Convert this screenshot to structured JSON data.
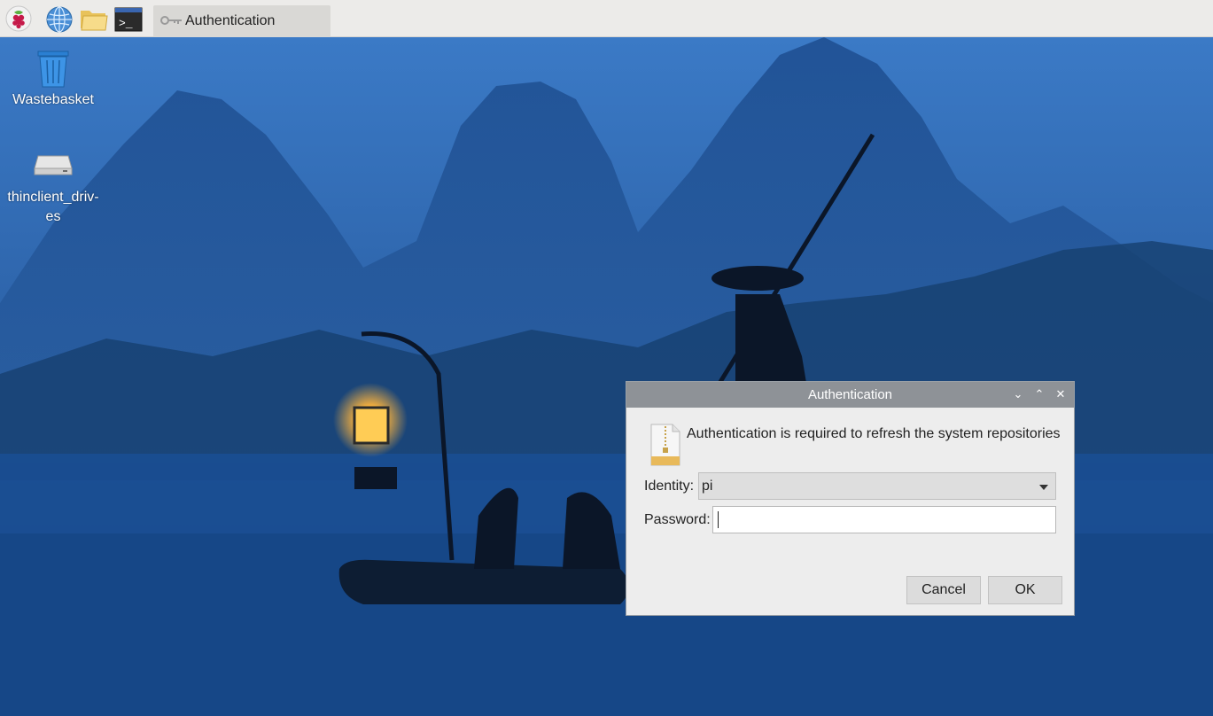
{
  "taskbar": {
    "launchers": [
      {
        "name": "raspberry-menu",
        "icon": "raspberry-icon"
      },
      {
        "name": "web-browser",
        "icon": "globe-icon"
      },
      {
        "name": "file-manager",
        "icon": "folder-icon"
      },
      {
        "name": "terminal",
        "icon": "terminal-icon"
      }
    ],
    "active_task": {
      "label": "Authentication",
      "icon": "keys-icon"
    }
  },
  "desktop": {
    "items": [
      {
        "label": "Wastebasket",
        "icon": "trash-icon"
      },
      {
        "label_line1": "thinclient_driv-",
        "label_line2": "es",
        "icon": "drive-icon"
      }
    ]
  },
  "dialog": {
    "title": "Authentication",
    "controls": {
      "minimize": "⌄",
      "maximize": "⌃",
      "close": "✕"
    },
    "message": "Authentication is required to refresh the system repositories",
    "message_icon": "package-archive-icon",
    "identity_label": "Identity:",
    "identity_value": "pi",
    "password_label": "Password:",
    "password_value": "",
    "cancel_label": "Cancel",
    "ok_label": "OK"
  },
  "colors": {
    "taskbar_bg": "#ecebe9",
    "titlebar_bg": "#8e9297",
    "dialog_bg": "#ededed",
    "wallpaper_sky": "#3f7bc4",
    "wallpaper_dark": "#163a70",
    "lantern_glow": "#ffb43a"
  }
}
